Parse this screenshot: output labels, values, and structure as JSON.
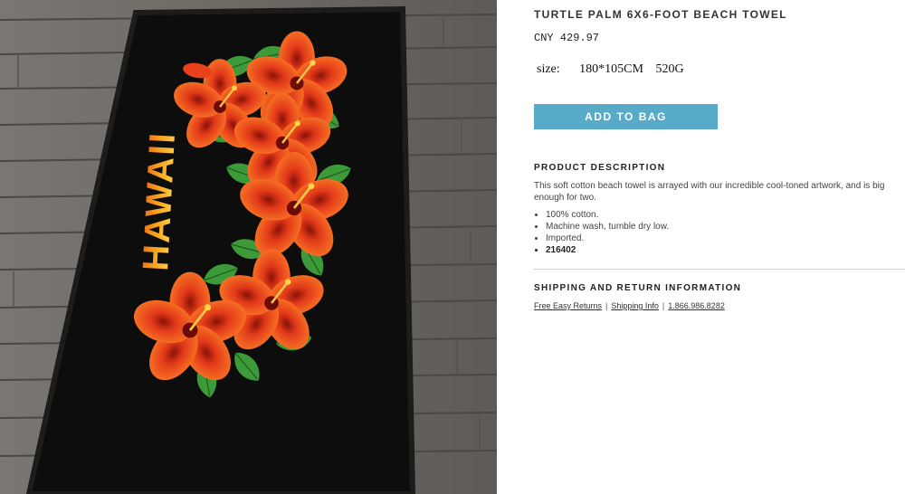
{
  "product": {
    "title": "TURTLE PALM 6X6-FOOT BEACH TOWEL",
    "price": "CNY 429.97",
    "size_label": "size:",
    "size_dims": "180*105CM",
    "size_weight": "520G",
    "add_to_bag": "ADD TO BAG",
    "image_text": "HAWAII"
  },
  "description": {
    "heading": "PRODUCT DESCRIPTION",
    "text": "This soft cotton beach towel is arrayed with our incredible cool-toned artwork, and is big enough for two.",
    "bullets": [
      "100% cotton.",
      "Machine wash, tumble dry low.",
      "Imported.",
      "216402"
    ]
  },
  "shipping": {
    "heading": "SHIPPING AND RETURN INFORMATION",
    "link_returns": "Free Easy Returns",
    "separator": "|",
    "link_shipping": "Shipping Info",
    "link_phone": "1.866.986.8282"
  },
  "colors": {
    "button": "#58aac9",
    "towel": "#0e0d0d",
    "deck": "#6d6a66",
    "hibiscus": "#e8411b"
  }
}
